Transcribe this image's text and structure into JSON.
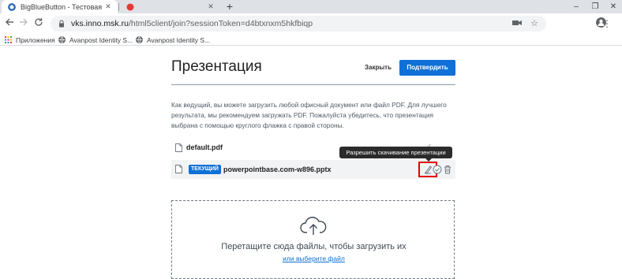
{
  "browser": {
    "tabs": [
      {
        "title": "BigBlueButton - Тестовая",
        "favicon_color": "#2d6cb5"
      },
      {
        "title": "",
        "favicon_color": "#e53935"
      }
    ],
    "new_tab_label": "+",
    "window_controls": {
      "minimize": "–",
      "maximize": "❐",
      "close": "✕"
    },
    "address": {
      "host": "vks.inno.msk.ru",
      "path": "/html5client/join?sessionToken=d4btxnxm5hkfbiqp"
    },
    "bookmarks": [
      {
        "label": "Приложения",
        "icon": "apps-grid-icon"
      },
      {
        "label": "Avanpost Identity S...",
        "icon": "globe-icon"
      },
      {
        "label": "Avanpost Identity S...",
        "icon": "globe-icon"
      }
    ]
  },
  "modal": {
    "title": "Презентация",
    "close_label": "Закрыть",
    "confirm_label": "Подтвердить",
    "instructions": "Как ведущий, вы можете загрузить любой офисный документ или файл PDF. Для лучшего результата, мы рекомендуем загружать PDF. Пожалуйста убедитесь, что презентация выбрана с помощью круглого флажка с правой стороны.",
    "files": [
      {
        "name": "default.pdf",
        "current": false
      },
      {
        "name": "powerpointbase.com-w896.pptx",
        "current": true,
        "badge": "ТЕКУЩИЙ"
      }
    ],
    "tooltip": "Разрешить скачивание презентации",
    "dropzone": {
      "text": "Перетащите сюда файлы, чтобы загрузить их",
      "link": "или выберите файл"
    }
  },
  "colors": {
    "accent": "#0f70d7",
    "highlight": "#e10000",
    "tab_strip": "#dee1e6"
  }
}
